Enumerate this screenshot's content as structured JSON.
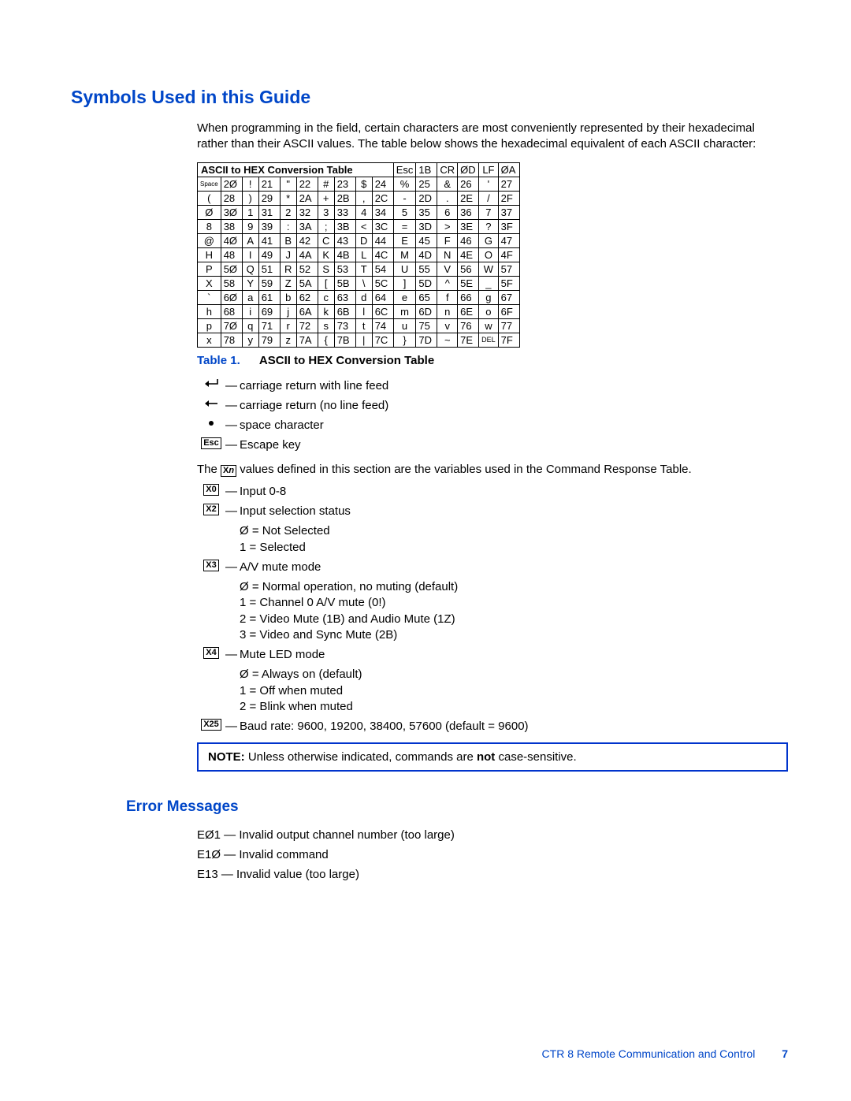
{
  "headings": {
    "symbols": "Symbols Used in this Guide",
    "errors": "Error Messages"
  },
  "intro": "When programming in the field, certain characters are most conveniently represented by their hexadecimal rather than their ASCII values. The table below shows the hexadecimal equivalent of each ASCII character:",
  "ascii_table": {
    "title": "ASCII to HEX  Conversion Table",
    "header_right": [
      [
        "Esc",
        "1B"
      ],
      [
        "CR",
        "ØD"
      ],
      [
        "LF",
        "ØA"
      ]
    ],
    "rows": [
      [
        [
          "Space",
          "2Ø"
        ],
        [
          "!",
          "21"
        ],
        [
          "\"",
          "22"
        ],
        [
          "#",
          "23"
        ],
        [
          "$",
          "24"
        ],
        [
          "%",
          "25"
        ],
        [
          "&",
          "26"
        ],
        [
          "'",
          "27"
        ]
      ],
      [
        [
          "(",
          "28"
        ],
        [
          ")",
          "29"
        ],
        [
          "*",
          "2A"
        ],
        [
          "+",
          "2B"
        ],
        [
          ",",
          "2C"
        ],
        [
          "-",
          "2D"
        ],
        [
          ".",
          "2E"
        ],
        [
          "/",
          "2F"
        ]
      ],
      [
        [
          "Ø",
          "3Ø"
        ],
        [
          "1",
          "31"
        ],
        [
          "2",
          "32"
        ],
        [
          "3",
          "33"
        ],
        [
          "4",
          "34"
        ],
        [
          "5",
          "35"
        ],
        [
          "6",
          "36"
        ],
        [
          "7",
          "37"
        ]
      ],
      [
        [
          "8",
          "38"
        ],
        [
          "9",
          "39"
        ],
        [
          ":",
          "3A"
        ],
        [
          ";",
          "3B"
        ],
        [
          "<",
          "3C"
        ],
        [
          "=",
          "3D"
        ],
        [
          ">",
          "3E"
        ],
        [
          "?",
          "3F"
        ]
      ],
      [
        [
          "@",
          "4Ø"
        ],
        [
          "A",
          "41"
        ],
        [
          "B",
          "42"
        ],
        [
          "C",
          "43"
        ],
        [
          "D",
          "44"
        ],
        [
          "E",
          "45"
        ],
        [
          "F",
          "46"
        ],
        [
          "G",
          "47"
        ]
      ],
      [
        [
          "H",
          "48"
        ],
        [
          "I",
          "49"
        ],
        [
          "J",
          "4A"
        ],
        [
          "K",
          "4B"
        ],
        [
          "L",
          "4C"
        ],
        [
          "M",
          "4D"
        ],
        [
          "N",
          "4E"
        ],
        [
          "O",
          "4F"
        ]
      ],
      [
        [
          "P",
          "5Ø"
        ],
        [
          "Q",
          "51"
        ],
        [
          "R",
          "52"
        ],
        [
          "S",
          "53"
        ],
        [
          "T",
          "54"
        ],
        [
          "U",
          "55"
        ],
        [
          "V",
          "56"
        ],
        [
          "W",
          "57"
        ]
      ],
      [
        [
          "X",
          "58"
        ],
        [
          "Y",
          "59"
        ],
        [
          "Z",
          "5A"
        ],
        [
          "[",
          "5B"
        ],
        [
          "\\",
          "5C"
        ],
        [
          "]",
          "5D"
        ],
        [
          "^",
          "5E"
        ],
        [
          "_",
          "5F"
        ]
      ],
      [
        [
          "`",
          "6Ø"
        ],
        [
          "a",
          "61"
        ],
        [
          "b",
          "62"
        ],
        [
          "c",
          "63"
        ],
        [
          "d",
          "64"
        ],
        [
          "e",
          "65"
        ],
        [
          "f",
          "66"
        ],
        [
          "g",
          "67"
        ]
      ],
      [
        [
          "h",
          "68"
        ],
        [
          "i",
          "69"
        ],
        [
          "j",
          "6A"
        ],
        [
          "k",
          "6B"
        ],
        [
          "l",
          "6C"
        ],
        [
          "m",
          "6D"
        ],
        [
          "n",
          "6E"
        ],
        [
          "o",
          "6F"
        ]
      ],
      [
        [
          "p",
          "7Ø"
        ],
        [
          "q",
          "71"
        ],
        [
          "r",
          "72"
        ],
        [
          "s",
          "73"
        ],
        [
          "t",
          "74"
        ],
        [
          "u",
          "75"
        ],
        [
          "v",
          "76"
        ],
        [
          "w",
          "77"
        ]
      ],
      [
        [
          "x",
          "78"
        ],
        [
          "y",
          "79"
        ],
        [
          "z",
          "7A"
        ],
        [
          "{",
          "7B"
        ],
        [
          "|",
          "7C"
        ],
        [
          "}",
          "7D"
        ],
        [
          "~",
          "7E"
        ],
        [
          "DEL",
          "7F"
        ]
      ]
    ]
  },
  "caption": {
    "label": "Table 1.",
    "text": "ASCII to HEX Conversion Table"
  },
  "symbols": [
    {
      "icon": "return-lf",
      "desc": "carriage return with line feed"
    },
    {
      "icon": "return",
      "desc": "carriage return (no line feed)"
    },
    {
      "icon": "bullet",
      "desc": "space character"
    },
    {
      "icon": "esc",
      "desc": "Escape key"
    }
  ],
  "xn_sentence": {
    "pre": "The ",
    "label": "Xn",
    "post": " values defined in this section are the variables used in the Command Response Table."
  },
  "vars": [
    {
      "label": "X0",
      "desc": "Input 0-8"
    },
    {
      "label": "X2",
      "desc": "Input selection status",
      "sub": [
        "Ø = Not Selected",
        "1 = Selected"
      ]
    },
    {
      "label": "X3",
      "desc": "A/V mute mode",
      "sub": [
        "Ø = Normal operation, no muting (default)",
        "1 = Channel 0 A/V mute (0!)",
        "2 = Video Mute (1B) and Audio Mute (1Z)",
        "3 = Video and Sync Mute (2B)"
      ]
    },
    {
      "label": "X4",
      "desc": "Mute LED mode",
      "sub": [
        "Ø = Always on (default)",
        "1 = Off when muted",
        "2 = Blink when muted"
      ]
    },
    {
      "label": "X25",
      "desc": "Baud rate: 9600, 19200, 38400, 57600 (default = 9600)"
    }
  ],
  "note": {
    "label": "NOTE:",
    "pre": "Unless otherwise indicated, commands are ",
    "bold": "not",
    "post": " case-sensitive."
  },
  "errors": [
    {
      "code": "EØ1",
      "desc": "Invalid output channel number (too large)"
    },
    {
      "code": "E1Ø",
      "desc": "Invalid command"
    },
    {
      "code": "E13",
      "desc": "Invalid value (too large)"
    }
  ],
  "footer": {
    "text": "CTR 8   Remote Communication and Control",
    "page": "7"
  }
}
